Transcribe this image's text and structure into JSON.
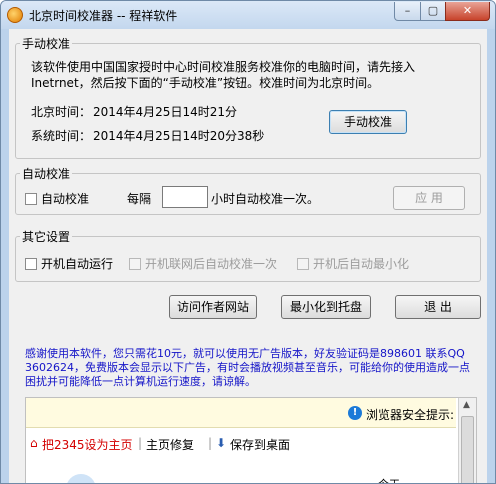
{
  "window": {
    "title": "北京时间校准器 -- 程祥软件",
    "min_glyph": "–",
    "max_glyph": "▢",
    "close_glyph": "✕"
  },
  "manual": {
    "legend": "手动校准",
    "description": "该软件使用中国国家授时中心时间校准服务校准你的电脑时间，请先接入Inetrnet，然后按下面的“手动校准”按钮。校准时间为北京时间。",
    "beijing_label": "北京时间：",
    "beijing_value": "2014年4月25日14时21分",
    "system_label": "系统时间：",
    "system_value": "2014年4月25日14时20分38秒",
    "button_label": "手动校准"
  },
  "auto": {
    "legend": "自动校准",
    "checkbox_label": "自动校准",
    "every_label": "每隔",
    "interval_value": "",
    "suffix_label": "小时自动校准一次。",
    "apply_label": "应  用"
  },
  "other": {
    "legend": "其它设置",
    "startup_label": "开机自动运行",
    "network_label": "开机联网后自动校准一次",
    "minimize_label": "开机后自动最小化"
  },
  "actions": {
    "visit_label": "访问作者网站",
    "tray_label": "最小化到托盘",
    "exit_label": "退  出"
  },
  "notice": {
    "text": "感谢使用本软件，您只需花10元，就可以使用无广告版本，好友验证码是898601 联系QQ3602624，免费版本会显示以下广告，有时会播放视频甚至音乐，可能给你的使用造成一点困扰并可能降低一点计算机运行速度，请谅解。"
  },
  "browser": {
    "info_icon": "!",
    "info_text": "浏览器安全提示:",
    "home_link": "把2345设为主页",
    "repair_link": "主页修复",
    "save_link": "保存到桌面",
    "partial_text": "今天",
    "home_color": "#d40000"
  }
}
